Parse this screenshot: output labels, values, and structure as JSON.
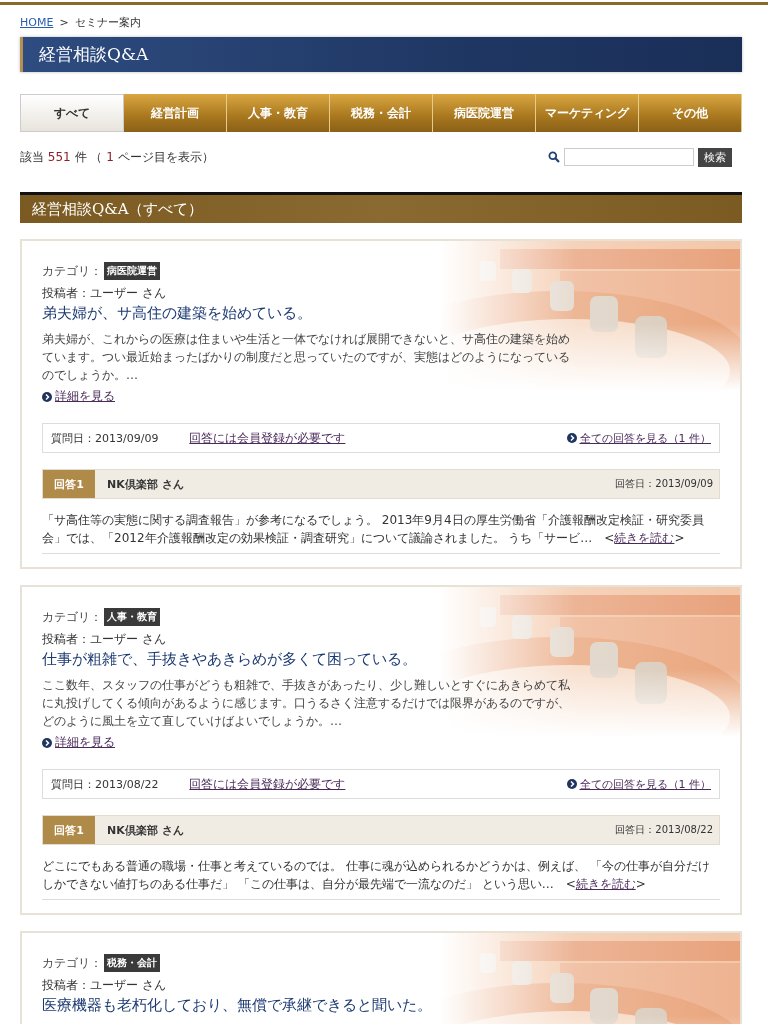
{
  "breadcrumb": {
    "home": "HOME",
    "separator": ">",
    "current": "セミナー案内"
  },
  "banner": {
    "title": "経営相談Q&A"
  },
  "tabs": [
    {
      "label": "すべて",
      "selected": true
    },
    {
      "label": "経営計画",
      "selected": false
    },
    {
      "label": "人事・教育",
      "selected": false
    },
    {
      "label": "税務・会計",
      "selected": false
    },
    {
      "label": "病医院運営",
      "selected": false
    },
    {
      "label": "マーケティング",
      "selected": false
    },
    {
      "label": "その他",
      "selected": false
    }
  ],
  "result": {
    "prefix": "該当",
    "count": "551",
    "middle": "件 （",
    "page": "1",
    "suffix": "ページ目を表示）"
  },
  "search": {
    "button": "検索"
  },
  "section": {
    "title": "経営相談Q&A（すべて）"
  },
  "questions": [
    {
      "category_label": "カテゴリ：",
      "category": "病医院運営",
      "author": "投稿者：ユーザー さん",
      "title": "弟夫婦が、サ高住の建築を始めている。",
      "body": "弟夫婦が、これからの医療は住まいや生活と一体でなければ展開できないと、サ高住の建築を始めています。つい最近始まったばかりの制度だと思っていたのですが、実態はどのようになっているのでしょうか。…",
      "detail": "詳細を見る",
      "date": "質問日：2013/09/09",
      "register": "回答には会員登録が必要です",
      "all_answers": "全ての回答を見る（1 件）",
      "answer": {
        "label": "回答1",
        "name": "NK倶楽部 さん",
        "date": "回答日：2013/09/09",
        "text": "「サ高住等の実態に関する調査報告」が参考になるでしょう。 2013年9月4日の厚生労働省「介護報酬改定検証・研究委員会」では、「2012年介護報酬改定の効果検証・調査研究」について議論されました。 うち「サービ…　",
        "open": "<",
        "more": "続きを読む",
        "close": ">"
      }
    },
    {
      "category_label": "カテゴリ：",
      "category": "人事・教育",
      "author": "投稿者：ユーザー さん",
      "title": "仕事が粗雑で、手抜きやあきらめが多くて困っている。",
      "body": "ここ数年、スタッフの仕事がどうも粗雑で、手抜きがあったり、少し難しいとすぐにあきらめて私に丸投げしてくる傾向があるように感じます。口うるさく注意するだけでは限界があるのですが、どのように風土を立て直していけばよいでしょうか。…",
      "detail": "詳細を見る",
      "date": "質問日：2013/08/22",
      "register": "回答には会員登録が必要です",
      "all_answers": "全ての回答を見る（1 件）",
      "answer": {
        "label": "回答1",
        "name": "NK倶楽部 さん",
        "date": "回答日：2013/08/22",
        "text": "どこにでもある普通の職場・仕事と考えているのでは。 仕事に魂が込められるかどうかは、例えば、 「今の仕事が自分だけしかできない値打ちのある仕事だ」 「この仕事は、自分が最先端で一流なのだ」 という思い…　",
        "open": "<",
        "more": "続きを読む",
        "close": ">"
      }
    },
    {
      "category_label": "カテゴリ：",
      "category": "税務・会計",
      "author": "投稿者：ユーザー さん",
      "title": "医療機器も老朽化しており、無償で承継できると聞いた。"
    }
  ]
}
